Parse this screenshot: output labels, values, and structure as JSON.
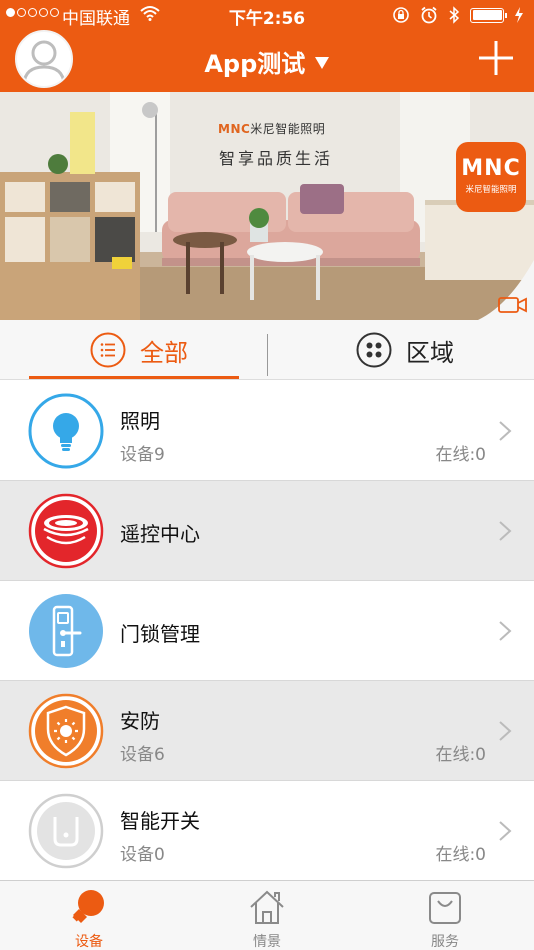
{
  "colors": {
    "accent": "#ec5b12",
    "row_alt_bg": "#e9e9e9"
  },
  "status_bar": {
    "carrier": "中国联通",
    "time": "下午2:56",
    "icons": [
      "signal-icon",
      "wifi-icon",
      "orientation-lock-icon",
      "alarm-icon",
      "bluetooth-icon",
      "battery-icon",
      "charging-icon"
    ]
  },
  "header": {
    "title": "App测试",
    "title_icon": "dropdown-triangle-icon",
    "left_icon": "avatar-icon",
    "right_icon": "plus-icon"
  },
  "banner": {
    "brand": "MNC",
    "brand_cn": "米尼智能照明",
    "slogan": "智享品质生活",
    "logo_text": "MNC",
    "logo_sub": "米尼智能照明",
    "corner_icon": "video-icon"
  },
  "tabs": [
    {
      "label": "全部",
      "icon": "list-icon",
      "active": true
    },
    {
      "label": "区域",
      "icon": "grid-icon",
      "active": false
    }
  ],
  "devices": [
    {
      "name": "照明",
      "count": "设备9",
      "online": "在线:0",
      "icon": "bulb-icon"
    },
    {
      "name": "遥控中心",
      "count": "",
      "online": "",
      "icon": "remote-hub-icon"
    },
    {
      "name": "门锁管理",
      "count": "",
      "online": "",
      "icon": "door-lock-icon"
    },
    {
      "name": "安防",
      "count": "设备6",
      "online": "在线:0",
      "icon": "security-shield-icon"
    },
    {
      "name": "智能开关",
      "count": "设备0",
      "online": "在线:0",
      "icon": "smart-switch-icon"
    }
  ],
  "tabbar": [
    {
      "label": "设备",
      "icon": "bulb-tab-icon",
      "active": true
    },
    {
      "label": "情景",
      "icon": "house-icon",
      "active": false
    },
    {
      "label": "服务",
      "icon": "bag-icon",
      "active": false
    }
  ]
}
